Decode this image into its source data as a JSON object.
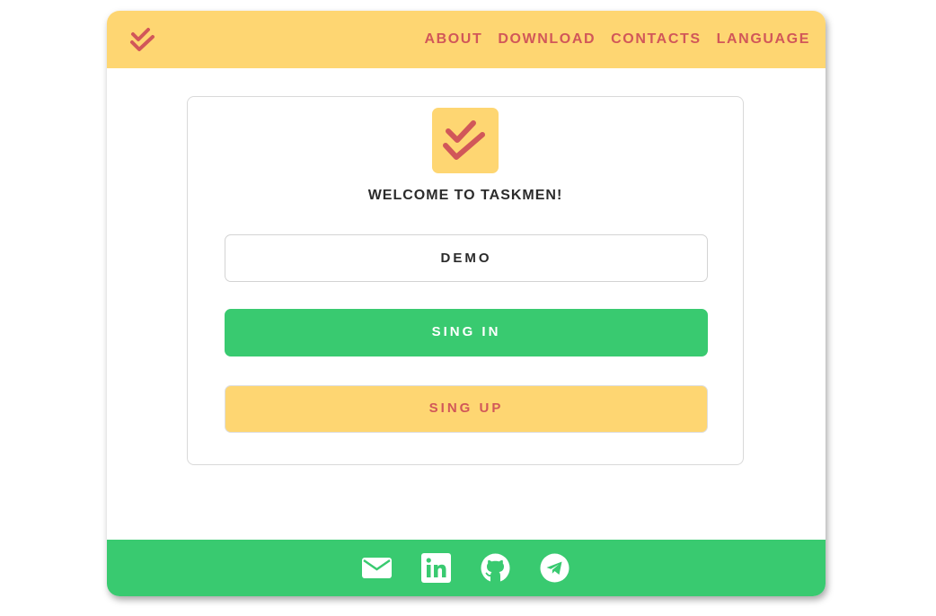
{
  "header": {
    "logo_icon": "double-check-icon",
    "nav": [
      {
        "label": "ABOUT"
      },
      {
        "label": "DOWNLOAD"
      },
      {
        "label": "CONTACTS"
      },
      {
        "label": "LANGUAGE"
      }
    ]
  },
  "login": {
    "logo_icon": "double-check-icon",
    "welcome": "WELCOME TO TASKMEN!",
    "username_value": "DEMO",
    "signin_label": "SING IN",
    "signup_label": "SING UP"
  },
  "footer": {
    "icons": [
      "mail-icon",
      "linkedin-icon",
      "github-icon",
      "telegram-icon"
    ]
  },
  "colors": {
    "header_bg": "#FED672",
    "accent_red": "#D15759",
    "green": "#39CA70",
    "text_dark": "#2b2b2b"
  }
}
